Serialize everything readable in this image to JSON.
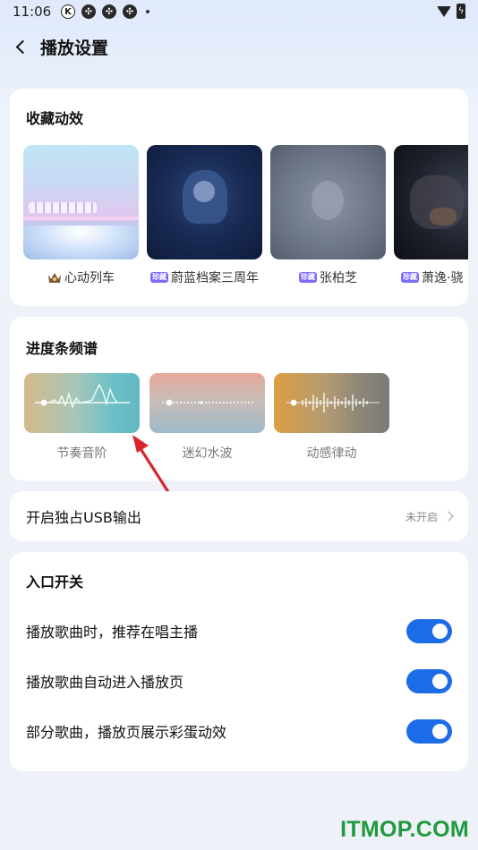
{
  "status": {
    "time": "11:06",
    "left_icons": [
      "k-icon",
      "pinwheel-icon",
      "pinwheel-icon",
      "pinwheel-icon"
    ]
  },
  "header": {
    "title": "播放设置"
  },
  "favorites": {
    "title": "收藏动效",
    "items": [
      {
        "label": "心动列车",
        "badge": "",
        "icon": "crown-icon"
      },
      {
        "label": "蔚蓝档案三周年",
        "badge": "珍藏"
      },
      {
        "label": "张柏芝",
        "badge": "珍藏"
      },
      {
        "label": "萧逸·骁",
        "badge": "珍藏"
      }
    ]
  },
  "spectrum": {
    "title": "进度条频谱",
    "items": [
      {
        "label": "节奏音阶"
      },
      {
        "label": "迷幻水波"
      },
      {
        "label": "动感律动"
      }
    ]
  },
  "usb": {
    "label": "开启独占USB输出",
    "value": "未开启"
  },
  "entry": {
    "title": "入口开关",
    "rows": [
      {
        "label": "播放歌曲时，推荐在唱主播",
        "on": true
      },
      {
        "label": "播放歌曲自动进入播放页",
        "on": true
      },
      {
        "label": "部分歌曲，播放页展示彩蛋动效",
        "on": true
      }
    ]
  },
  "colors": {
    "accent": "#1c6ce8",
    "arrow": "#d8262b",
    "watermark": "#1f9a3e"
  },
  "watermark": "ITMOP.COM"
}
